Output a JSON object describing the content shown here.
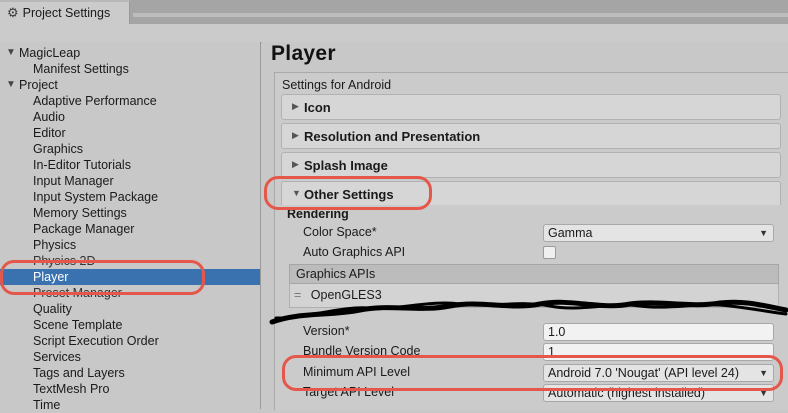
{
  "window": {
    "tab_title": "Project Settings",
    "tab_icon": "gear-icon"
  },
  "sidebar": {
    "items": [
      {
        "label": "MagicLeap",
        "expandable": true
      },
      {
        "label": "Manifest Settings"
      },
      {
        "label": "Project",
        "expandable": true
      },
      {
        "label": "Adaptive Performance"
      },
      {
        "label": "Audio"
      },
      {
        "label": "Editor"
      },
      {
        "label": "Graphics"
      },
      {
        "label": "In-Editor Tutorials"
      },
      {
        "label": "Input Manager"
      },
      {
        "label": "Input System Package"
      },
      {
        "label": "Memory Settings"
      },
      {
        "label": "Package Manager"
      },
      {
        "label": "Physics"
      },
      {
        "label": "Physics 2D"
      },
      {
        "label": "Player",
        "selected": true
      },
      {
        "label": "Preset Manager"
      },
      {
        "label": "Quality"
      },
      {
        "label": "Scene Template"
      },
      {
        "label": "Script Execution Order"
      },
      {
        "label": "Services"
      },
      {
        "label": "Tags and Layers"
      },
      {
        "label": "TextMesh Pro"
      },
      {
        "label": "Time"
      }
    ]
  },
  "main": {
    "title": "Player",
    "subtitle": "Settings for Android",
    "foldouts": {
      "icon": "Icon",
      "resolution": "Resolution and Presentation",
      "splash": "Splash Image",
      "other": "Other Settings"
    },
    "rendering": {
      "section_label": "Rendering",
      "color_space_label": "Color Space*",
      "color_space_value": "Gamma",
      "auto_graphics_label": "Auto Graphics API",
      "auto_graphics_checked": false,
      "graphics_apis_header": "Graphics APIs",
      "graphics_apis": [
        "OpenGLES3"
      ]
    },
    "identification": {
      "version_label": "Version*",
      "version_value": "1.0",
      "bundle_code_label": "Bundle Version Code",
      "bundle_code_value": "1",
      "min_api_label": "Minimum API Level",
      "min_api_value": "Android 7.0 'Nougat' (API level 24)",
      "target_api_label": "Target API Level",
      "target_api_value": "Automatic (highest installed)"
    }
  },
  "colors": {
    "selection": "#3a72b0",
    "annotation": "#e4574a",
    "scribble": "#000000"
  }
}
